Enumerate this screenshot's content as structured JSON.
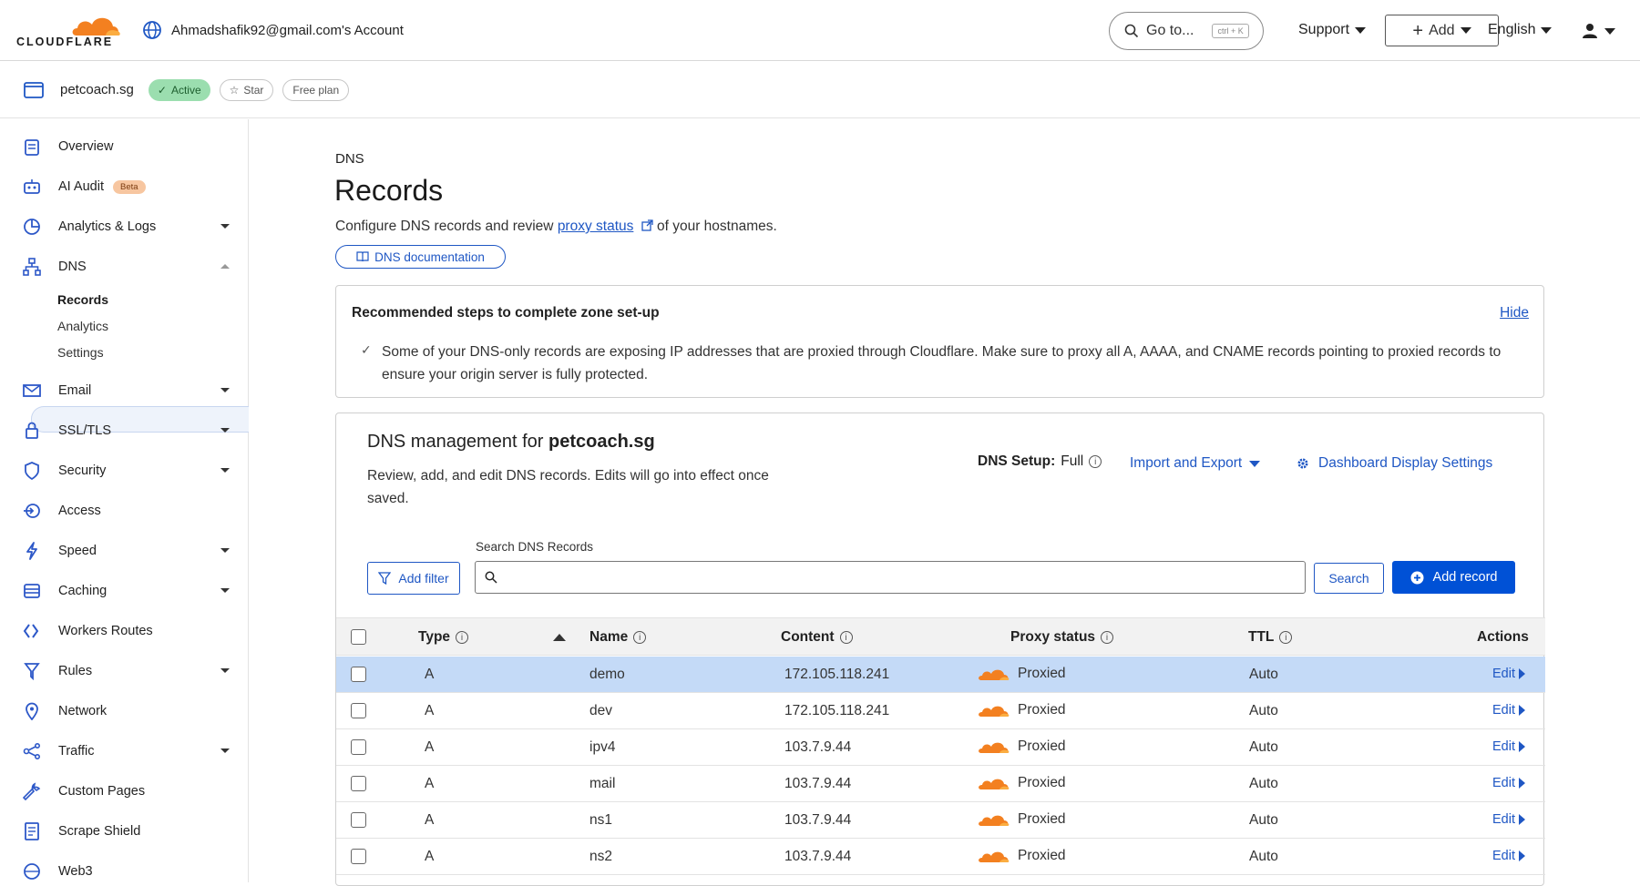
{
  "header": {
    "logo_text": "CLOUDFLARE",
    "account": "Ahmadshafik92@gmail.com's Account",
    "goto_label": "Go to...",
    "goto_shortcut": "ctrl + K",
    "support": "Support",
    "add": "Add",
    "language": "English"
  },
  "zone": {
    "name": "petcoach.sg",
    "status": "Active",
    "star": "Star",
    "plan": "Free plan"
  },
  "sidebar": {
    "overview": "Overview",
    "ai_audit": "AI Audit",
    "ai_badge": "Beta",
    "analytics_logs": "Analytics & Logs",
    "dns": "DNS",
    "dns_sub": {
      "records": "Records",
      "analytics": "Analytics",
      "settings": "Settings"
    },
    "email": "Email",
    "ssl": "SSL/TLS",
    "security": "Security",
    "access": "Access",
    "speed": "Speed",
    "caching": "Caching",
    "workers": "Workers Routes",
    "rules": "Rules",
    "network": "Network",
    "traffic": "Traffic",
    "custom_pages": "Custom Pages",
    "scrape_shield": "Scrape Shield",
    "web3": "Web3"
  },
  "main": {
    "crumb": "DNS",
    "title": "Records",
    "desc_pre": "Configure DNS records and review ",
    "desc_link": "proxy status",
    "desc_post": " of your hostnames.",
    "doc_button": "DNS documentation"
  },
  "recommend": {
    "heading": "Recommended steps to complete zone set-up",
    "hide": "Hide",
    "message": "Some of your DNS-only records are exposing IP addresses that are proxied through Cloudflare. Make sure to proxy all A, AAAA, and CNAME records pointing to proxied records to ensure your origin server is fully protected."
  },
  "management": {
    "title_pre": "DNS management for ",
    "title_zone": "petcoach.sg",
    "desc": "Review, add, and edit DNS records. Edits will go into effect once saved.",
    "setup_label": "DNS Setup:",
    "setup_value": "Full",
    "import_export": "Import and Export",
    "display_settings": "Dashboard Display Settings",
    "add_filter": "Add filter",
    "search_label": "Search DNS Records",
    "search_placeholder": "",
    "search_button": "Search",
    "add_record": "Add record"
  },
  "table": {
    "headers": {
      "type": "Type",
      "name": "Name",
      "content": "Content",
      "proxy": "Proxy status",
      "ttl": "TTL",
      "actions": "Actions"
    },
    "rows": [
      {
        "type": "A",
        "name": "demo",
        "content": "172.105.118.241",
        "proxy": "Proxied",
        "ttl": "Auto",
        "action": "Edit"
      },
      {
        "type": "A",
        "name": "dev",
        "content": "172.105.118.241",
        "proxy": "Proxied",
        "ttl": "Auto",
        "action": "Edit"
      },
      {
        "type": "A",
        "name": "ipv4",
        "content": "103.7.9.44",
        "proxy": "Proxied",
        "ttl": "Auto",
        "action": "Edit"
      },
      {
        "type": "A",
        "name": "mail",
        "content": "103.7.9.44",
        "proxy": "Proxied",
        "ttl": "Auto",
        "action": "Edit"
      },
      {
        "type": "A",
        "name": "ns1",
        "content": "103.7.9.44",
        "proxy": "Proxied",
        "ttl": "Auto",
        "action": "Edit"
      },
      {
        "type": "A",
        "name": "ns2",
        "content": "103.7.9.44",
        "proxy": "Proxied",
        "ttl": "Auto",
        "action": "Edit"
      }
    ]
  },
  "colors": {
    "accent": "#1f57c4",
    "primary_button": "#0051d6",
    "cloud": "#f38020",
    "selected_row": "#c4daf7",
    "active_badge": "#9bdeaf"
  }
}
